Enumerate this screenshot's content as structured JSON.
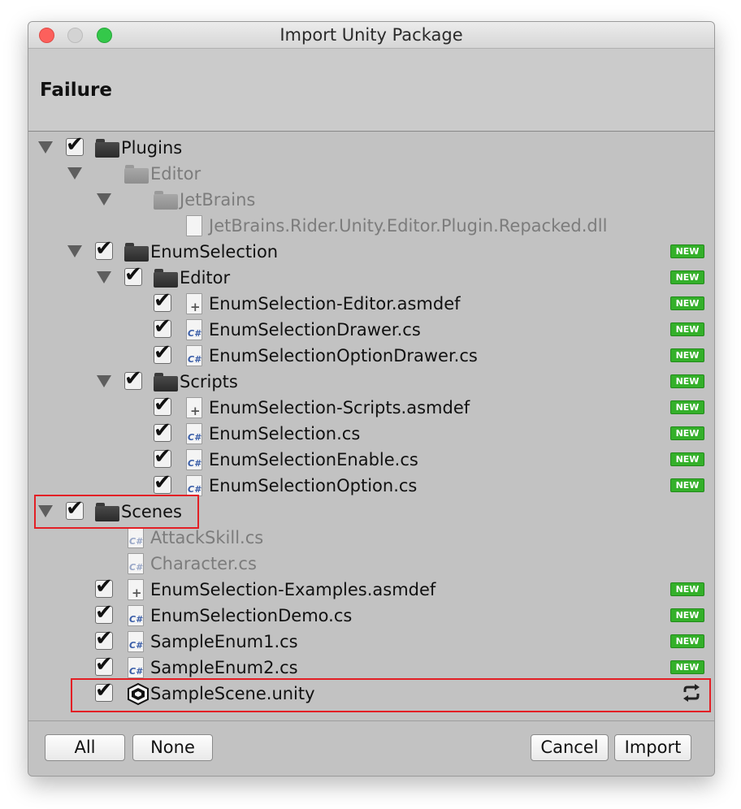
{
  "window": {
    "title": "Import Unity Package"
  },
  "header": {
    "title": "Failure"
  },
  "tree": [
    {
      "label": "Plugins",
      "depth": 0,
      "icon": "folder-icon",
      "checked": true,
      "expanded": true,
      "enabled": true,
      "badge": ""
    },
    {
      "label": "Editor",
      "depth": 1,
      "icon": "folder-icon",
      "checked": false,
      "expanded": true,
      "enabled": false,
      "badge": ""
    },
    {
      "label": "JetBrains",
      "depth": 2,
      "icon": "folder-icon",
      "checked": false,
      "expanded": true,
      "enabled": false,
      "badge": ""
    },
    {
      "label": "JetBrains.Rider.Unity.Editor.Plugin.Repacked.dll",
      "depth": 3,
      "icon": "dll-file-icon",
      "checked": false,
      "expanded": false,
      "enabled": false,
      "badge": ""
    },
    {
      "label": "EnumSelection",
      "depth": 1,
      "icon": "folder-icon",
      "checked": true,
      "expanded": true,
      "enabled": true,
      "badge": "NEW"
    },
    {
      "label": "Editor",
      "depth": 2,
      "icon": "folder-icon",
      "checked": true,
      "expanded": true,
      "enabled": true,
      "badge": "NEW"
    },
    {
      "label": "EnumSelection-Editor.asmdef",
      "depth": 3,
      "icon": "asmdef-file-icon",
      "checked": true,
      "expanded": false,
      "enabled": true,
      "badge": "NEW"
    },
    {
      "label": "EnumSelectionDrawer.cs",
      "depth": 3,
      "icon": "csharp-file-icon",
      "checked": true,
      "expanded": false,
      "enabled": true,
      "badge": "NEW"
    },
    {
      "label": "EnumSelectionOptionDrawer.cs",
      "depth": 3,
      "icon": "csharp-file-icon",
      "checked": true,
      "expanded": false,
      "enabled": true,
      "badge": "NEW"
    },
    {
      "label": "Scripts",
      "depth": 2,
      "icon": "folder-icon",
      "checked": true,
      "expanded": true,
      "enabled": true,
      "badge": "NEW"
    },
    {
      "label": "EnumSelection-Scripts.asmdef",
      "depth": 3,
      "icon": "asmdef-file-icon",
      "checked": true,
      "expanded": false,
      "enabled": true,
      "badge": "NEW"
    },
    {
      "label": "EnumSelection.cs",
      "depth": 3,
      "icon": "csharp-file-icon",
      "checked": true,
      "expanded": false,
      "enabled": true,
      "badge": "NEW"
    },
    {
      "label": "EnumSelectionEnable.cs",
      "depth": 3,
      "icon": "csharp-file-icon",
      "checked": true,
      "expanded": false,
      "enabled": true,
      "badge": "NEW"
    },
    {
      "label": "EnumSelectionOption.cs",
      "depth": 3,
      "icon": "csharp-file-icon",
      "checked": true,
      "expanded": false,
      "enabled": true,
      "badge": "NEW"
    },
    {
      "label": "Scenes",
      "depth": 0,
      "icon": "folder-icon",
      "checked": true,
      "expanded": true,
      "enabled": true,
      "badge": ""
    },
    {
      "label": "AttackSkill.cs",
      "depth": 1,
      "icon": "csharp-file-icon",
      "checked": false,
      "expanded": false,
      "enabled": false,
      "badge": ""
    },
    {
      "label": "Character.cs",
      "depth": 1,
      "icon": "csharp-file-icon",
      "checked": false,
      "expanded": false,
      "enabled": false,
      "badge": ""
    },
    {
      "label": "EnumSelection-Examples.asmdef",
      "depth": 1,
      "icon": "asmdef-file-icon",
      "checked": true,
      "expanded": false,
      "enabled": true,
      "badge": "NEW"
    },
    {
      "label": "EnumSelectionDemo.cs",
      "depth": 1,
      "icon": "csharp-file-icon",
      "checked": true,
      "expanded": false,
      "enabled": true,
      "badge": "NEW"
    },
    {
      "label": "SampleEnum1.cs",
      "depth": 1,
      "icon": "csharp-file-icon",
      "checked": true,
      "expanded": false,
      "enabled": true,
      "badge": "NEW"
    },
    {
      "label": "SampleEnum2.cs",
      "depth": 1,
      "icon": "csharp-file-icon",
      "checked": true,
      "expanded": false,
      "enabled": true,
      "badge": "NEW"
    },
    {
      "label": "SampleScene.unity",
      "depth": 1,
      "icon": "unity-scene-icon",
      "checked": true,
      "expanded": false,
      "enabled": true,
      "badge": "",
      "status_icon": "refresh-icon"
    }
  ],
  "footer": {
    "all_label": "All",
    "none_label": "None",
    "cancel_label": "Cancel",
    "import_label": "Import"
  },
  "colors": {
    "new_badge": "#34b02a",
    "highlight": "#e31f25",
    "panel_bg": "#c2c2c2"
  }
}
